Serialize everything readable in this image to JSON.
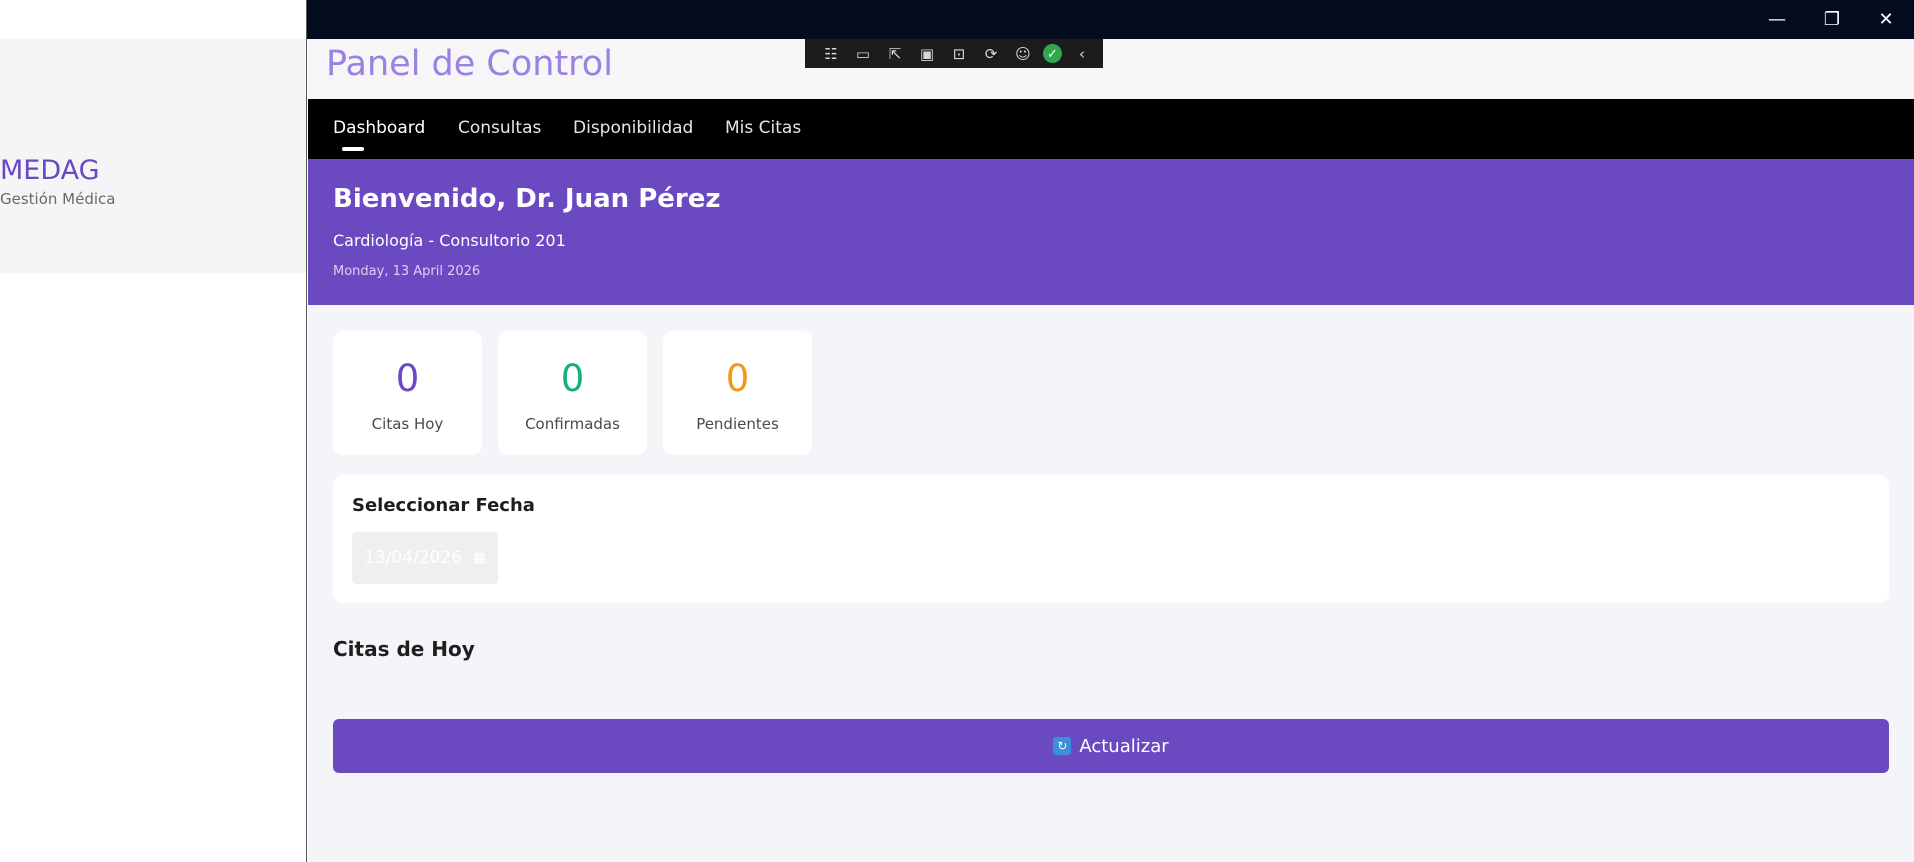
{
  "window": {
    "minimize_glyph": "—",
    "restore_glyph": "❐",
    "close_glyph": "✕"
  },
  "sidebar": {
    "brand": "MEDAG",
    "subtitle": "Gestión Médica"
  },
  "header": {
    "title": "Panel de Control"
  },
  "devtools": {
    "icons": [
      "live-visual-tree-icon",
      "record-icon",
      "select-element-icon",
      "display-layout-adorners-icon",
      "track-focus-icon",
      "hot-reload-icon",
      "accessibility-icon",
      "ok-check-icon",
      "collapse-chevron-icon"
    ]
  },
  "nav": {
    "items": [
      {
        "label": "Dashboard",
        "active": true
      },
      {
        "label": "Consultas",
        "active": false
      },
      {
        "label": "Disponibilidad",
        "active": false
      },
      {
        "label": "Mis Citas",
        "active": false
      }
    ]
  },
  "banner": {
    "welcome": "Bienvenido, Dr. Juan Pérez",
    "specialty": "Cardiología - Consultorio 201",
    "date": "Monday, 13 April 2026"
  },
  "stats": [
    {
      "value": "0",
      "label": "Citas Hoy",
      "color": "#6b49c1"
    },
    {
      "value": "0",
      "label": "Confirmadas",
      "color": "#18b07a"
    },
    {
      "value": "0",
      "label": "Pendientes",
      "color": "#f19a1a"
    }
  ],
  "date_picker": {
    "title": "Seleccionar Fecha",
    "value": "13/04/2026",
    "calendar_glyph": "▦"
  },
  "appointments": {
    "title": "Citas de Hoy"
  },
  "refresh_button": {
    "icon": "refresh-icon",
    "label": "Actualizar"
  },
  "colors": {
    "accent": "#6b49c1",
    "nav_bg": "#000000",
    "titlebar_bg": "#040b1e"
  }
}
